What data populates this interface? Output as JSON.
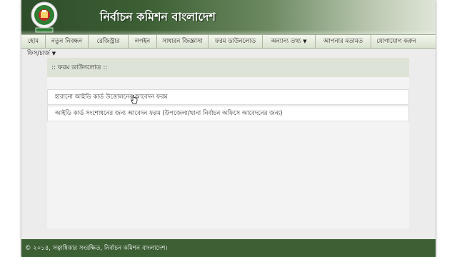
{
  "header": {
    "title": "নির্বাচন কমিশন বাংলাদেশ",
    "logo_icon": "election-commission-emblem-icon"
  },
  "nav": {
    "items": [
      {
        "label": "হোম"
      },
      {
        "label": "নতুন নিবন্ধন"
      },
      {
        "label": "রেজিস্ট্রার"
      },
      {
        "label": "লগইন"
      },
      {
        "label": "সাধারন জিজ্ঞাসা"
      },
      {
        "label": "ফরম ডাউনলোড"
      },
      {
        "label": "অন্যান্য তথ্য",
        "dropdown": "▼"
      },
      {
        "label": "আপনার মতামত"
      },
      {
        "label": "যোগাযোগ করুন"
      }
    ],
    "row2": {
      "label": "ফিস/চার্জ",
      "dropdown": "▼"
    }
  },
  "main": {
    "section_title": ":: ফরম ডাউনলোড ::",
    "downloads": [
      {
        "label": "হারানো আইডি কার্ড উত্তোলনের আবেদন ফরম"
      },
      {
        "label": "আইডি কার্ড সংশোধনের জন্য আবেদন ফরম (উপজেলা/থানা নির্বাচন অফিসে আবেদনের জন্য)"
      }
    ]
  },
  "footer": {
    "copyright": "© ২০১৪, সত্বাধিকার সংরক্ষিত, নির্বাচন কমিশন বাংলাদেশ।"
  },
  "colors": {
    "header_dark": "#2e4d2a",
    "footer": "#3c5f34",
    "nav_bg": "#e5ecdd",
    "section_head_bg": "#dde3d6"
  }
}
